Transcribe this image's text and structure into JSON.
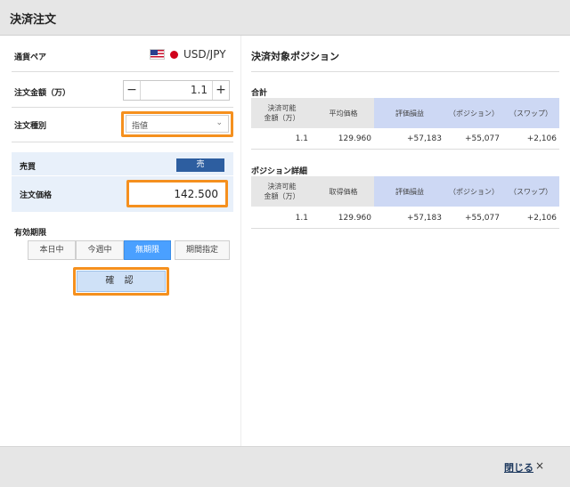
{
  "window": {
    "title": "決済注文",
    "close_label": "閉じる",
    "close_icon": "×"
  },
  "form": {
    "pair_label": "通貨ペア",
    "pair_value": "USD/JPY",
    "amount_label": "注文金額（万）",
    "amount_value": "1.1",
    "minus": "−",
    "plus": "+",
    "order_type_label": "注文種別",
    "order_type_value": "指値",
    "side_label": "売買",
    "side_value": "売",
    "price_label": "注文価格",
    "price_value": "142.500",
    "expiry_label": "有効期限",
    "expiry_options": [
      "本日中",
      "今週中",
      "無期限",
      "期間指定"
    ],
    "expiry_selected": "無期限",
    "confirm_label": "確 認"
  },
  "positions": {
    "title": "決済対象ポジション",
    "summary": {
      "title": "合計",
      "headers": [
        "決済可能\n金額（万）",
        "平均価格",
        "評価損益",
        "（ポジション）",
        "（スワップ）"
      ],
      "row": [
        "1.1",
        "129.960",
        "+57,183",
        "+55,077",
        "+2,106"
      ]
    },
    "detail": {
      "title": "ポジション詳細",
      "headers": [
        "決済可能\n金額（万）",
        "取得価格",
        "評価損益",
        "（ポジション）",
        "（スワップ）"
      ],
      "row": [
        "1.1",
        "129.960",
        "+57,183",
        "+55,077",
        "+2,106"
      ]
    }
  },
  "colors": {
    "accent": "#2d5ea0",
    "highlight": "#f5901e",
    "active_segment": "#4aa0ff",
    "header_blue": "#cdd8f4"
  }
}
